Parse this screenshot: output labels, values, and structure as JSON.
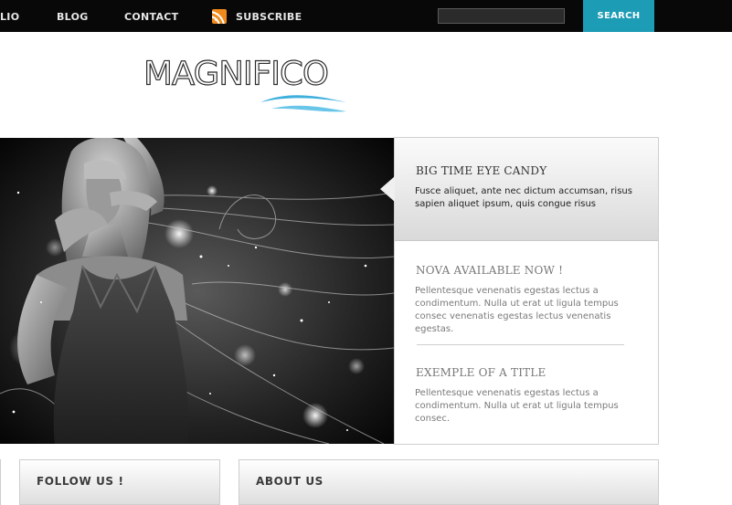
{
  "nav": {
    "items": [
      "LIO",
      "BLOG",
      "CONTACT"
    ],
    "subscribe_label": "SUBSCRIBE",
    "search_value": "",
    "search_button_label": "SEARCH"
  },
  "logo": {
    "text": "MAGNIFICO"
  },
  "feature": {
    "title": "BIG TIME EYE CANDY",
    "text": "Fusce aliquet, ante nec dictum accumsan, risus sapien aliquet ipsum, quis congue risus"
  },
  "posts": [
    {
      "title": "NOVA AVAILABLE NOW !",
      "text": "Pellentesque venenatis egestas lectus a condimentum. Nulla ut erat ut ligula tempus consec venenatis egestas lectus venenatis egestas."
    },
    {
      "title": "EXEMPLE OF A TITLE",
      "text": "Pellentesque venenatis egestas lectus a condimentum. Nulla ut erat ut ligula tempus consec."
    }
  ],
  "boxes": {
    "follow_title": "FOLLOW US !",
    "about_title": "ABOUT US"
  },
  "colors": {
    "topbar": "#080808",
    "accent": "#1c9cb5",
    "rss": "#f08a1c",
    "logo_swoosh": "#3fb0dc"
  },
  "icons": {
    "rss": "rss-icon"
  }
}
